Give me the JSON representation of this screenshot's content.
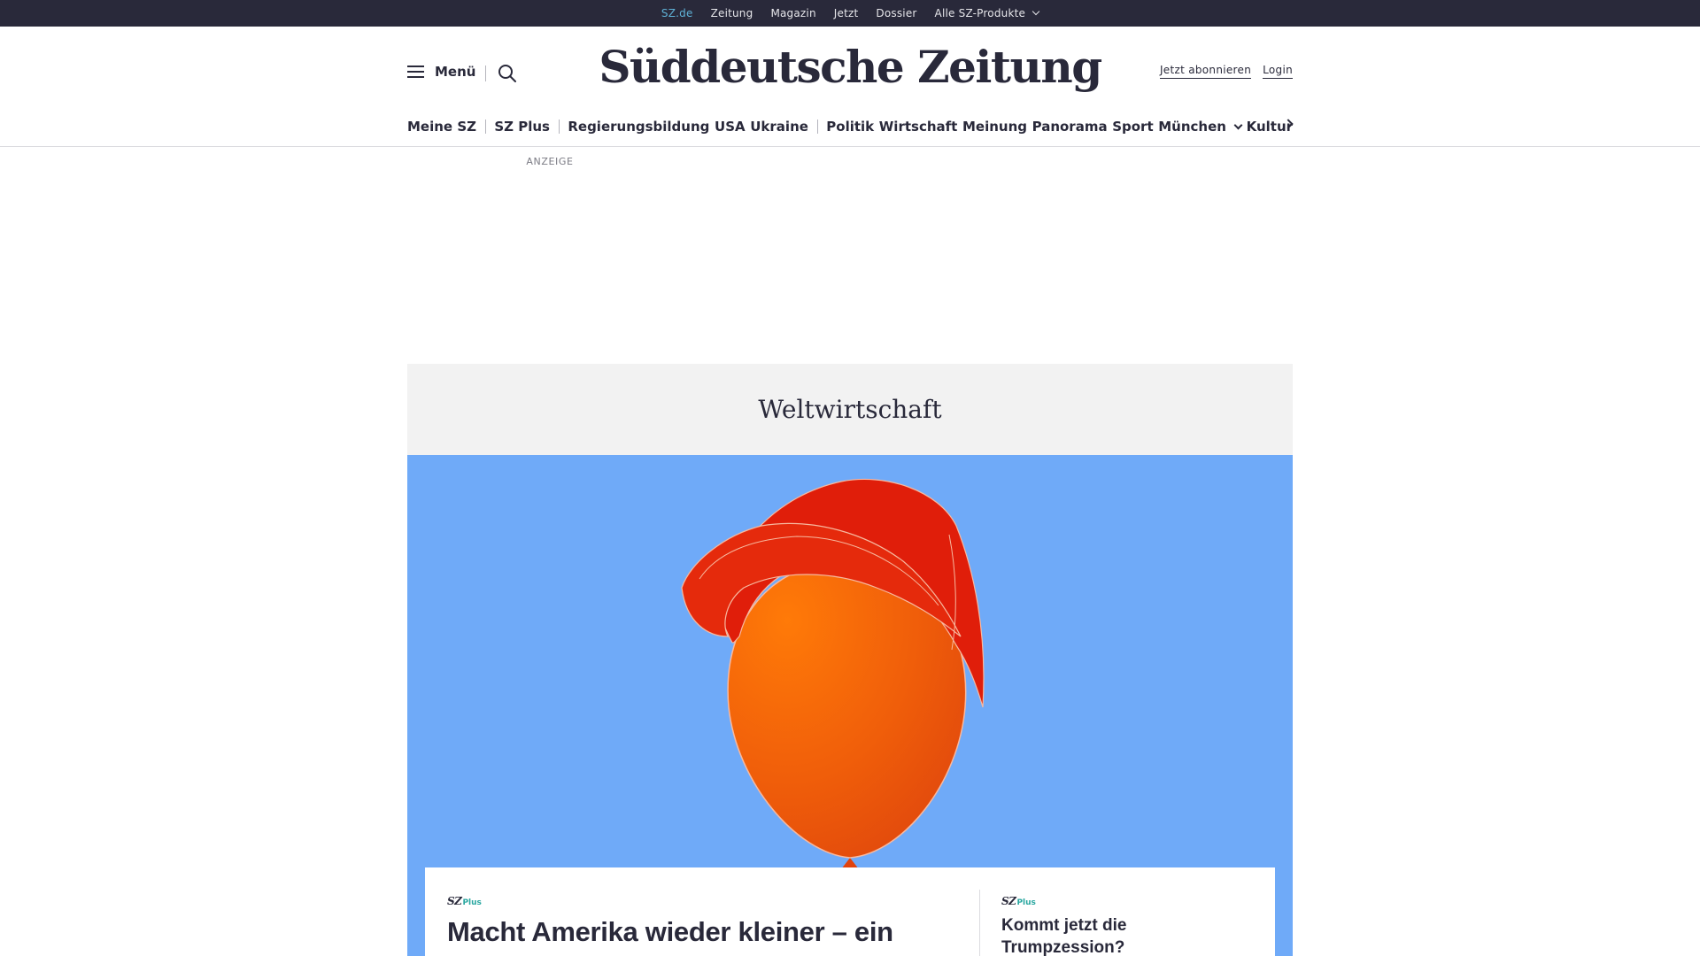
{
  "topbar": {
    "links": [
      {
        "label": "SZ.de",
        "active": true
      },
      {
        "label": "Zeitung"
      },
      {
        "label": "Magazin"
      },
      {
        "label": "Jetzt"
      },
      {
        "label": "Dossier"
      },
      {
        "label": "Alle SZ-Produkte",
        "dropdown": true
      }
    ]
  },
  "header": {
    "menu_label": "Menü",
    "logo": "Süddeutsche Zeitung",
    "subscribe_label": "Jetzt abonnieren",
    "login_label": "Login"
  },
  "nav": {
    "items": [
      "Meine SZ",
      "SZ Plus",
      "Regierungsbildung",
      "USA",
      "Ukraine",
      "Politik",
      "Wirtschaft",
      "Meinung",
      "Panorama",
      "Sport",
      "München",
      "Kultur"
    ]
  },
  "ad": {
    "label": "ANZEIGE"
  },
  "section": {
    "title": "Weltwirtschaft"
  },
  "teaser": {
    "badge_sz": "SZ",
    "badge_plus": "Plus",
    "main_title": "Macht Amerika wieder kleiner – ein",
    "side_title": "Kommt jetzt die Trumpzession?"
  },
  "colors": {
    "topbar_bg": "#29293a",
    "active_link": "#5fb1d6",
    "teaser_bg": "#6faaf8",
    "cap": "#e01e0a",
    "balloon": "#f26a0a",
    "plus_accent": "#29a7a0"
  }
}
